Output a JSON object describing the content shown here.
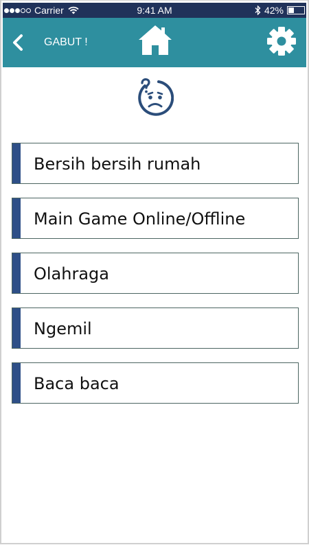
{
  "status_bar": {
    "carrier": "Carrier",
    "time": "9:41 AM",
    "battery": "42%",
    "battery_level": 0.42,
    "signal_full": 3,
    "signal_empty": 2
  },
  "header": {
    "title": "GABUT !",
    "back_icon": "chevron-left-icon",
    "home_icon": "home-icon",
    "settings_icon": "gear-icon",
    "color": "#2e8f9f"
  },
  "mood": {
    "icon": "confused-face-icon",
    "color": "#2b4d7a"
  },
  "activities": [
    {
      "label": "Bersih bersih rumah"
    },
    {
      "label": "Main Game Online/Offline"
    },
    {
      "label": "Olahraga"
    },
    {
      "label": "Ngemil"
    },
    {
      "label": "Baca baca"
    }
  ],
  "colors": {
    "status_bar_bg": "#20325a",
    "accent_bar": "#2e4f87",
    "item_border": "#4b6460"
  }
}
